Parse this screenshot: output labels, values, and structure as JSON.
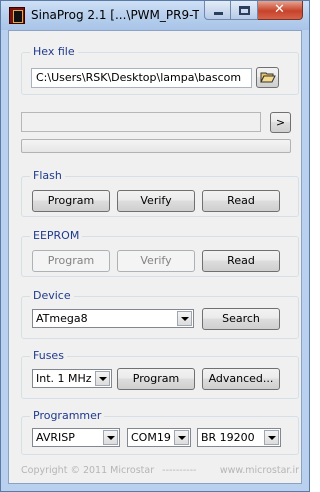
{
  "window": {
    "title": "SinaProg 2.1 [...\\PWM_PR9-T..."
  },
  "hex_file": {
    "label": "Hex file",
    "path": "C:\\Users\\RSK\\Desktop\\lampa\\bascom",
    "open_icon": "folder-open-icon"
  },
  "status": {
    "text": "",
    "next_label": ">",
    "progress": 0
  },
  "flash": {
    "label": "Flash",
    "program": "Program",
    "verify": "Verify",
    "read": "Read"
  },
  "eeprom": {
    "label": "EEPROM",
    "program": "Program",
    "verify": "Verify",
    "read": "Read"
  },
  "device": {
    "label": "Device",
    "selected": "ATmega8",
    "search": "Search"
  },
  "fuses": {
    "label": "Fuses",
    "selected": "Int. 1 MHz",
    "program": "Program",
    "advanced": "Advanced..."
  },
  "programmer": {
    "label": "Programmer",
    "type": "AVRISP",
    "port": "COM19",
    "baud": "BR 19200"
  },
  "footer": {
    "copyright": "Copyright © 2011 Microstar",
    "separator": "----------",
    "website": "www.microstar.ir"
  },
  "colors": {
    "group_label": "#1e3a8c",
    "client_bg": "#f0f0f0",
    "title_bg": "#b9d1ee",
    "close_button": "#c7432b"
  }
}
